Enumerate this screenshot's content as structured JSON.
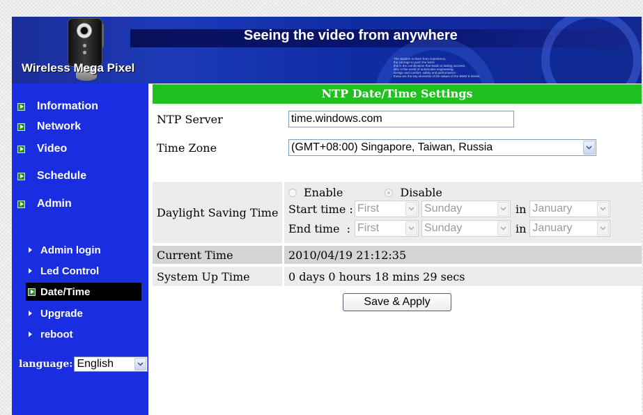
{
  "header": {
    "title": "Seeing the video from anywhere",
    "brand": "Wireless Mega Pixel",
    "blurb": [
      "The wisdom to learn from experience,",
      "the courage to push the limits",
      "this is the combination that leads to lasting success,",
      "also in the world of automotive engineering.",
      "Design and comfort, safety and performance -",
      "these are the key elements of the values of the BMW 5 Series."
    ]
  },
  "sidebar": {
    "items": [
      {
        "label": "Information",
        "icon": "green-play-icon"
      },
      {
        "label": "Network",
        "icon": "green-play-icon"
      },
      {
        "label": "Video",
        "icon": "green-play-icon"
      },
      {
        "label": "Schedule",
        "icon": "green-play-icon"
      },
      {
        "label": "Admin",
        "icon": "green-play-icon"
      }
    ],
    "subitems": [
      {
        "label": "Admin login"
      },
      {
        "label": "Led Control"
      },
      {
        "label": "Date/Time",
        "selected": true
      },
      {
        "label": "Upgrade"
      },
      {
        "label": "reboot"
      }
    ],
    "language": {
      "label": "language:",
      "value": "English"
    }
  },
  "main": {
    "title": "NTP Date/Time Settings",
    "ntp_server": {
      "label": "NTP Server",
      "value": "time.windows.com"
    },
    "time_zone": {
      "label": "Time Zone",
      "value": "(GMT+08:00) Singapore, Taiwan, Russia"
    },
    "dst": {
      "label": "Daylight Saving Time",
      "enable_label": "Enable",
      "disable_label": "Disable",
      "selected": "Disable",
      "start_label": "Start time :",
      "end_label": "End time  :",
      "in_label": "in",
      "start": {
        "week": "First",
        "day": "Sunday",
        "month": "January"
      },
      "end": {
        "week": "First",
        "day": "Sunday",
        "month": "January"
      }
    },
    "current_time": {
      "label": "Current Time",
      "value": "2010/04/19 21:12:35"
    },
    "uptime": {
      "label": "System Up Time",
      "value": "0 days 0 hours 18 mins 29 secs"
    },
    "save_label": "Save & Apply"
  },
  "colors": {
    "sidebar_bg": "#1a2de1",
    "title_bar": "#20c020",
    "selected_nav": "#000000",
    "row_dark": "#d4d4d4",
    "row_light": "#ececec"
  }
}
